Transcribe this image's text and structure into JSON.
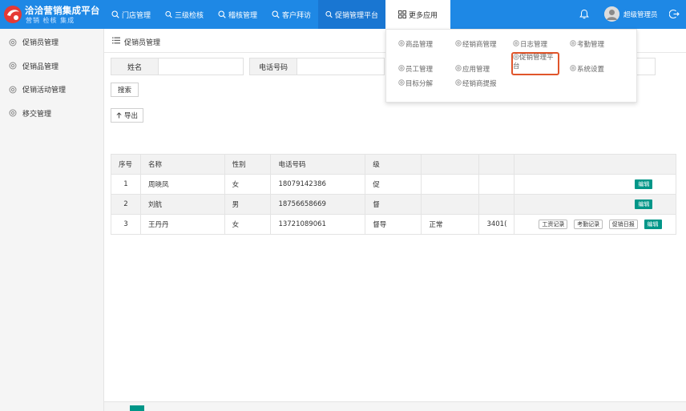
{
  "app": {
    "title": "洽洽营销集成平台",
    "subtitle": "营销 检核 集成",
    "brand_color": "#1e88e5",
    "accent_color": "#009688",
    "highlight_color": "#e0552b"
  },
  "nav": {
    "items": [
      {
        "label": "门店管理",
        "icon": "search-icon"
      },
      {
        "label": "三级检核",
        "icon": "search-icon"
      },
      {
        "label": "稽核管理",
        "icon": "search-icon"
      },
      {
        "label": "客户拜访",
        "icon": "search-icon"
      },
      {
        "label": "促销管理平台",
        "icon": "search-icon"
      }
    ],
    "more_label": "更多应用",
    "more_icon": "grid-icon"
  },
  "user": {
    "name": "超级管理员"
  },
  "sidebar": {
    "items": [
      {
        "label": "促销员管理",
        "icon": "gear-icon"
      },
      {
        "label": "促销品管理",
        "icon": "gear-icon"
      },
      {
        "label": "促销活动管理",
        "icon": "gear-icon"
      },
      {
        "label": "移交管理",
        "icon": "gear-icon"
      }
    ]
  },
  "breadcrumb": {
    "current": "促销员管理"
  },
  "filters": {
    "name_label": "姓名",
    "name_value": "",
    "phone_label": "电话号码",
    "phone_value": "",
    "search_button": "搜索",
    "export_button": "导出"
  },
  "table": {
    "columns": [
      "序号",
      "名称",
      "性别",
      "电话号码",
      "级"
    ],
    "rows": [
      {
        "index": "1",
        "name": "周晓凤",
        "gender": "女",
        "phone": "18079142386",
        "level": "促",
        "status": "",
        "code": "",
        "actions": []
      },
      {
        "index": "2",
        "name": "刘航",
        "gender": "男",
        "phone": "18756658669",
        "level": "督",
        "status": "",
        "code": "",
        "actions": []
      },
      {
        "index": "3",
        "name": "王丹丹",
        "gender": "女",
        "phone": "13721089061",
        "level": "督导",
        "status": "正常",
        "code": "3401(",
        "actions": [
          "工资记录",
          "考勤记录",
          "促销日报"
        ]
      }
    ],
    "edit_label": "编辑"
  },
  "more_menu": {
    "items": [
      "商品管理",
      "经销商管理",
      "日志管理",
      "考勤管理",
      "员工管理",
      "应用管理",
      "促销管理平台",
      "系统设置",
      "目标分解",
      "经销商提报"
    ]
  }
}
